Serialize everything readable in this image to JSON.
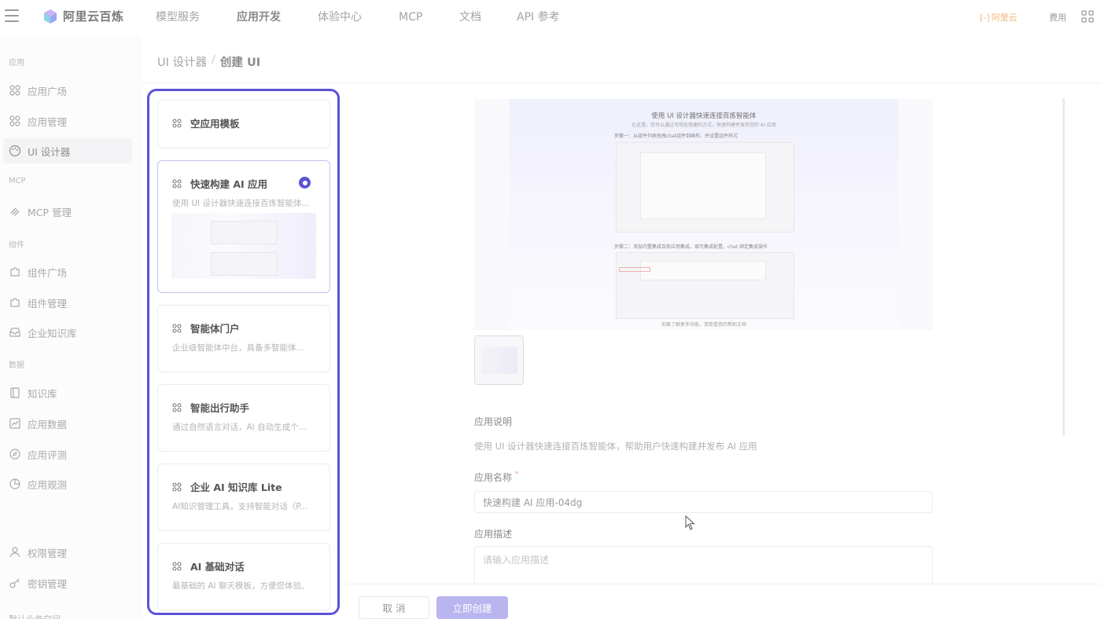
{
  "topbar": {
    "brand": "阿里云百炼",
    "nav": [
      "模型服务",
      "应用开发",
      "体验中心",
      "MCP",
      "文档",
      "API 参考"
    ],
    "active_nav": "应用开发",
    "aliyun": "阿里云",
    "fee": "费用"
  },
  "sidebar": {
    "sections": [
      {
        "title": "应用",
        "items": [
          "应用广场",
          "应用管理",
          "UI 设计器"
        ]
      },
      {
        "title": "MCP",
        "items": [
          "MCP 管理"
        ]
      },
      {
        "title": "组件",
        "items": [
          "组件广场",
          "组件管理",
          "企业知识库"
        ]
      },
      {
        "title": "数据",
        "items": [
          "知识库",
          "应用数据",
          "应用评测",
          "应用观测"
        ]
      }
    ],
    "bottom_items": [
      "权限管理",
      "密钥管理"
    ],
    "active_item": "UI 设计器",
    "bottom_cut_text": "默认业务空间"
  },
  "breadcrumb": {
    "parent": "UI 设计器",
    "separator": "/",
    "current": "创建 UI"
  },
  "templates": [
    {
      "title": "空应用模板",
      "desc": ""
    },
    {
      "title": "快速构建 AI 应用",
      "desc": "使用 UI 设计器快速连接百炼智能体...",
      "selected": true
    },
    {
      "title": "智能体门户",
      "desc": "企业级智能体中台，具备多智能体..."
    },
    {
      "title": "智能出行助手",
      "desc": "通过自然语言对话，AI 自动生成个..."
    },
    {
      "title": "企业 AI 知识库 Lite",
      "desc": "AI知识管理工具，支持智能对话（P..."
    },
    {
      "title": "AI 基础对话",
      "desc": "最基础的 AI 聊天模板，方便您体验。"
    }
  ],
  "preview": {
    "title": "使用 UI 设计器快速连接百炼智能体",
    "subtitle": "在这里，您可以通过可视化搭建的方式，快速构建并发布您的 AI 应用",
    "step1": "步骤一：从组件列表拖拽chat组件到画布，并设置组件样式",
    "step2": "步骤二：添加内置集成百炼应用集成，填写集成配置，chat 绑定集成操作",
    "footer": "如果了解更多功能，请查看我的帮助文档"
  },
  "form": {
    "desc_label": "应用说明",
    "desc_text": "使用 UI 设计器快速连接百炼智能体，帮助用户快速构建并发布 AI 应用",
    "name_label": "应用名称",
    "name_required_mark": "*",
    "name_value": "快速构建 AI 应用-04dg",
    "description_label": "应用描述",
    "description_placeholder": "请输入应用描述"
  },
  "actions": {
    "cancel": "取 消",
    "create": "立即创建"
  },
  "colors": {
    "accent": "#5b53d6",
    "accent_light": "#b9b5ef",
    "aliyun_orange": "#f0b77a"
  }
}
